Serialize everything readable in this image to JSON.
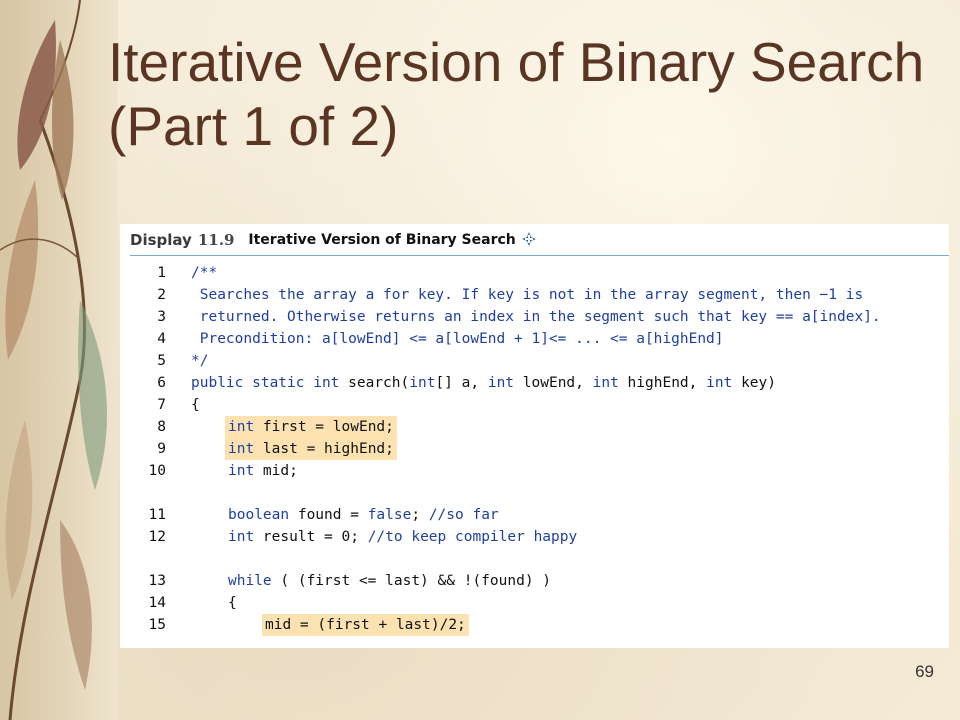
{
  "slide": {
    "title_line1": "Iterative Version of Binary Search",
    "title_line2": "(Part 1 of 2)",
    "page_number": "69"
  },
  "display": {
    "label": "Display",
    "number": "11.9",
    "title": "Iterative Version of Binary Search",
    "icon": "plus-diamond-icon"
  },
  "code_lines": [
    {
      "n": "1",
      "indent": 0,
      "highlight": false,
      "segments": [
        {
          "t": "/**",
          "c": "cm"
        }
      ]
    },
    {
      "n": "2",
      "indent": 0,
      "highlight": false,
      "segments": [
        {
          "t": " Searches the array a for key. If key is not in the array segment, then −1 is",
          "c": "cm"
        }
      ]
    },
    {
      "n": "3",
      "indent": 0,
      "highlight": false,
      "segments": [
        {
          "t": " returned. Otherwise returns an index in the segment such that key == a[index].",
          "c": "cm"
        }
      ]
    },
    {
      "n": "4",
      "indent": 0,
      "highlight": false,
      "segments": [
        {
          "t": " Precondition: a[lowEnd] <= a[lowEnd + 1]<= ... <= a[highEnd]",
          "c": "cm"
        }
      ]
    },
    {
      "n": "5",
      "indent": 0,
      "highlight": false,
      "segments": [
        {
          "t": "*/",
          "c": "cm"
        }
      ]
    },
    {
      "n": "6",
      "indent": 0,
      "highlight": false,
      "segments": [
        {
          "t": "public static int ",
          "c": "kw"
        },
        {
          "t": "search(",
          "c": ""
        },
        {
          "t": "int",
          "c": "kw"
        },
        {
          "t": "[] a, ",
          "c": ""
        },
        {
          "t": "int",
          "c": "kw"
        },
        {
          "t": " lowEnd, ",
          "c": ""
        },
        {
          "t": "int",
          "c": "kw"
        },
        {
          "t": " highEnd, ",
          "c": ""
        },
        {
          "t": "int",
          "c": "kw"
        },
        {
          "t": " key)",
          "c": ""
        }
      ]
    },
    {
      "n": "7",
      "indent": 0,
      "highlight": false,
      "segments": [
        {
          "t": "{",
          "c": ""
        }
      ]
    },
    {
      "n": "8",
      "indent": 1,
      "highlight": true,
      "segments": [
        {
          "t": "int",
          "c": "kw"
        },
        {
          "t": " first = lowEnd;",
          "c": ""
        }
      ]
    },
    {
      "n": "9",
      "indent": 1,
      "highlight": true,
      "segments": [
        {
          "t": "int",
          "c": "kw"
        },
        {
          "t": " last = highEnd;",
          "c": ""
        }
      ]
    },
    {
      "n": "10",
      "indent": 1,
      "highlight": false,
      "segments": [
        {
          "t": "int",
          "c": "kw"
        },
        {
          "t": " mid;",
          "c": ""
        }
      ]
    },
    {
      "n": "11",
      "indent": 1,
      "highlight": false,
      "gap": true,
      "segments": [
        {
          "t": "boolean",
          "c": "kw"
        },
        {
          "t": " found = ",
          "c": ""
        },
        {
          "t": "false",
          "c": "kw"
        },
        {
          "t": "; ",
          "c": ""
        },
        {
          "t": "//so far",
          "c": "cm"
        }
      ]
    },
    {
      "n": "12",
      "indent": 1,
      "highlight": false,
      "segments": [
        {
          "t": "int",
          "c": "kw"
        },
        {
          "t": " result = 0; ",
          "c": ""
        },
        {
          "t": "//to keep compiler happy",
          "c": "cm"
        }
      ]
    },
    {
      "n": "13",
      "indent": 1,
      "highlight": false,
      "gap": true,
      "segments": [
        {
          "t": "while",
          "c": "kw"
        },
        {
          "t": " ( (first <= last) && !(found) )",
          "c": ""
        }
      ]
    },
    {
      "n": "14",
      "indent": 1,
      "highlight": false,
      "segments": [
        {
          "t": "{",
          "c": ""
        }
      ]
    },
    {
      "n": "15",
      "indent": 2,
      "highlight": true,
      "segments": [
        {
          "t": "mid = (first + last)/2;",
          "c": ""
        }
      ]
    }
  ],
  "colors": {
    "title": "#5a3523",
    "keyword": "#1f3fa0",
    "highlight": "#fbe2b0",
    "rule": "#7fa6c7"
  }
}
